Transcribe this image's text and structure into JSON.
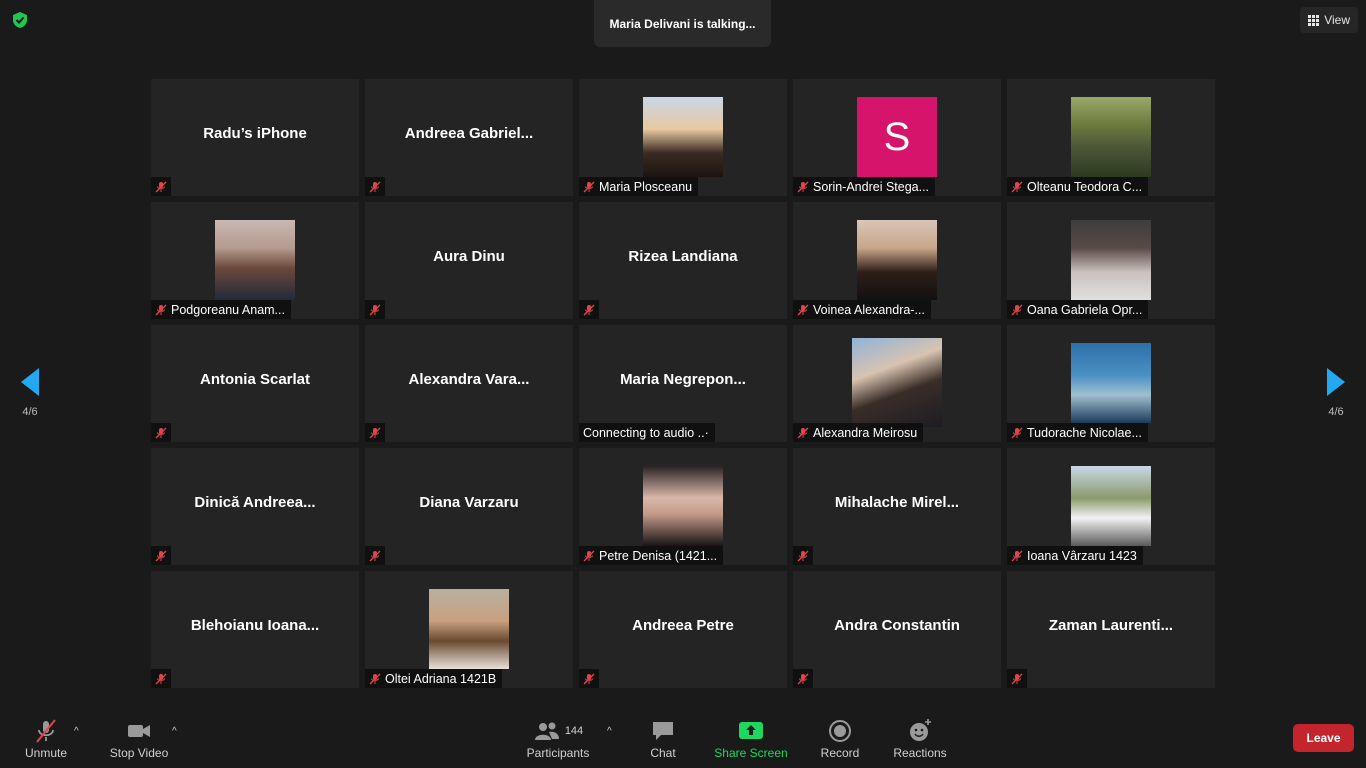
{
  "header": {
    "talking_text": "Maria Delivani is talking...",
    "view_label": "View",
    "security_icon": "shield-check-icon"
  },
  "nav": {
    "page_left": "4/6",
    "page_right": "4/6"
  },
  "tiles": [
    {
      "name": "Radu’s iPhone",
      "type": "name"
    },
    {
      "name": "Andreea  Gabriel...",
      "type": "name"
    },
    {
      "name": "Maria Plosceanu",
      "type": "photo"
    },
    {
      "name": "Sorin-Andrei Stega...",
      "type": "photo",
      "avatar_letter": "S"
    },
    {
      "name": "Olteanu Teodora C...",
      "type": "photo"
    },
    {
      "name": "Podgoreanu Anam...",
      "type": "photo"
    },
    {
      "name": "Aura Dinu",
      "type": "name"
    },
    {
      "name": "Rizea Landiana",
      "type": "name"
    },
    {
      "name": "Voinea Alexandra-...",
      "type": "photo"
    },
    {
      "name": "Oana Gabriela Opr...",
      "type": "photo"
    },
    {
      "name": "Antonia Scarlat",
      "type": "name"
    },
    {
      "name": "Alexandra  Vara...",
      "type": "name"
    },
    {
      "name": "Maria  Negrepon...",
      "type": "name",
      "status": "Connecting to audio ..·"
    },
    {
      "name": "Alexandra Meirosu",
      "type": "photo"
    },
    {
      "name": "Tudorache Nicolae...",
      "type": "photo"
    },
    {
      "name": "Dinică  Andreea...",
      "type": "name"
    },
    {
      "name": "Diana Varzaru",
      "type": "name"
    },
    {
      "name": "Petre Denisa (1421...",
      "type": "photo"
    },
    {
      "name": "Mihalache  Mirel...",
      "type": "name"
    },
    {
      "name": "Ioana Vârzaru 1423",
      "type": "photo"
    },
    {
      "name": "Blehoianu  Ioana...",
      "type": "name"
    },
    {
      "name": "Oltei Adriana 1421B",
      "type": "photo"
    },
    {
      "name": "Andreea Petre",
      "type": "name"
    },
    {
      "name": "Andra Constantin",
      "type": "name"
    },
    {
      "name": "Zaman  Laurenti...",
      "type": "name"
    }
  ],
  "toolbar": {
    "unmute": "Unmute",
    "stop_video": "Stop Video",
    "participants": "Participants",
    "participants_count": "144",
    "chat": "Chat",
    "share_screen": "Share Screen",
    "record": "Record",
    "reactions": "Reactions",
    "leave": "Leave"
  },
  "colors": {
    "accent_blue": "#23a8f2",
    "share_green": "#1ed760",
    "leave_red": "#c4242b",
    "muted_red": "#e0454a"
  }
}
